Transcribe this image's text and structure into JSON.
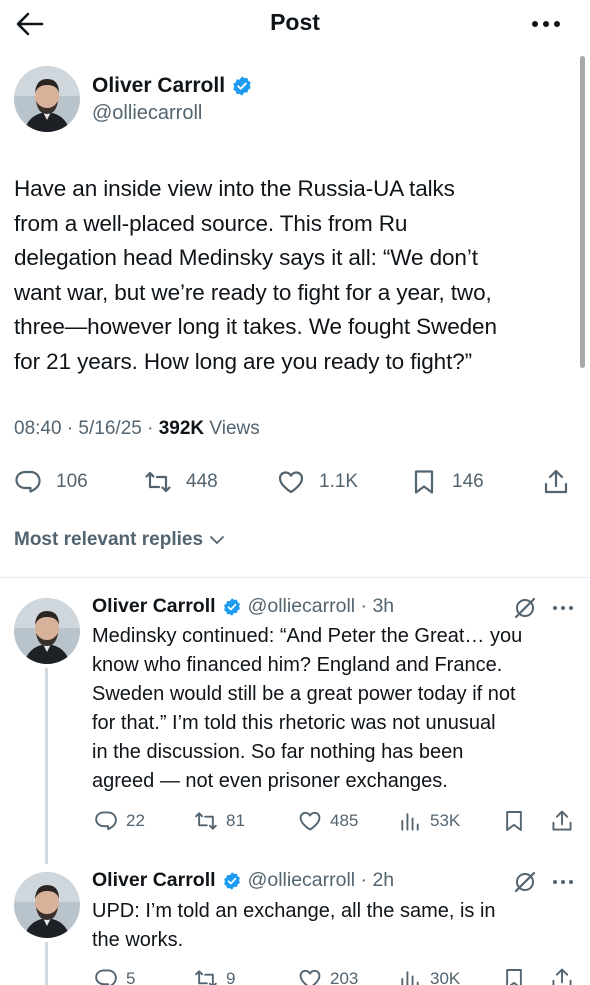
{
  "header": {
    "title": "Post"
  },
  "tweet": {
    "name": "Oliver Carroll",
    "handle": "@olliecarroll",
    "text": "Have an inside view into the Russia-UA talks\nfrom a well-placed source. This from Ru\ndelegation head Medinsky says it all: “We don’t\nwant war, but we’re ready to fight for a year, two,\nthree—however long it takes. We fought Sweden\nfor 21 years. How long are you ready to fight?”",
    "time": "08:40 · 5/16/25 · ",
    "views_count": "392K",
    "views_label": " Views",
    "replies": "106",
    "reposts": "448",
    "likes": "1.1K",
    "bookmarks": "146"
  },
  "replies_filter": {
    "label": "Most relevant replies"
  },
  "replies": [
    {
      "name": "Oliver Carroll",
      "handle": "@olliecarroll · 3h",
      "lines": [
        "Medinsky continued: “And Peter the Great… you",
        "know who financed him? England and France.",
        "Sweden would still be a great power today if not",
        "for that.” I’m told this rhetoric was not unusual",
        "in the discussion. So far nothing has been",
        "agreed — not even prisoner exchanges."
      ],
      "replies": "22",
      "reposts": "81",
      "likes": "485",
      "views": "53K"
    },
    {
      "name": "Oliver Carroll",
      "handle": "@olliecarroll · 2h",
      "lines": [
        "UPD: I’m told an exchange, all the same, is in",
        "the works."
      ],
      "replies": "5",
      "reposts": "9",
      "likes": "203",
      "views": "30K"
    }
  ],
  "colors": {
    "verified": "#1d9bf0",
    "text": "#0f1419",
    "secondary": "#536471"
  },
  "icons": [
    "back-arrow-icon",
    "more-icon",
    "verified-icon",
    "reply-icon",
    "repost-icon",
    "like-icon",
    "bookmark-icon",
    "share-icon",
    "views-icon",
    "grok-icon",
    "chevron-down-icon"
  ]
}
